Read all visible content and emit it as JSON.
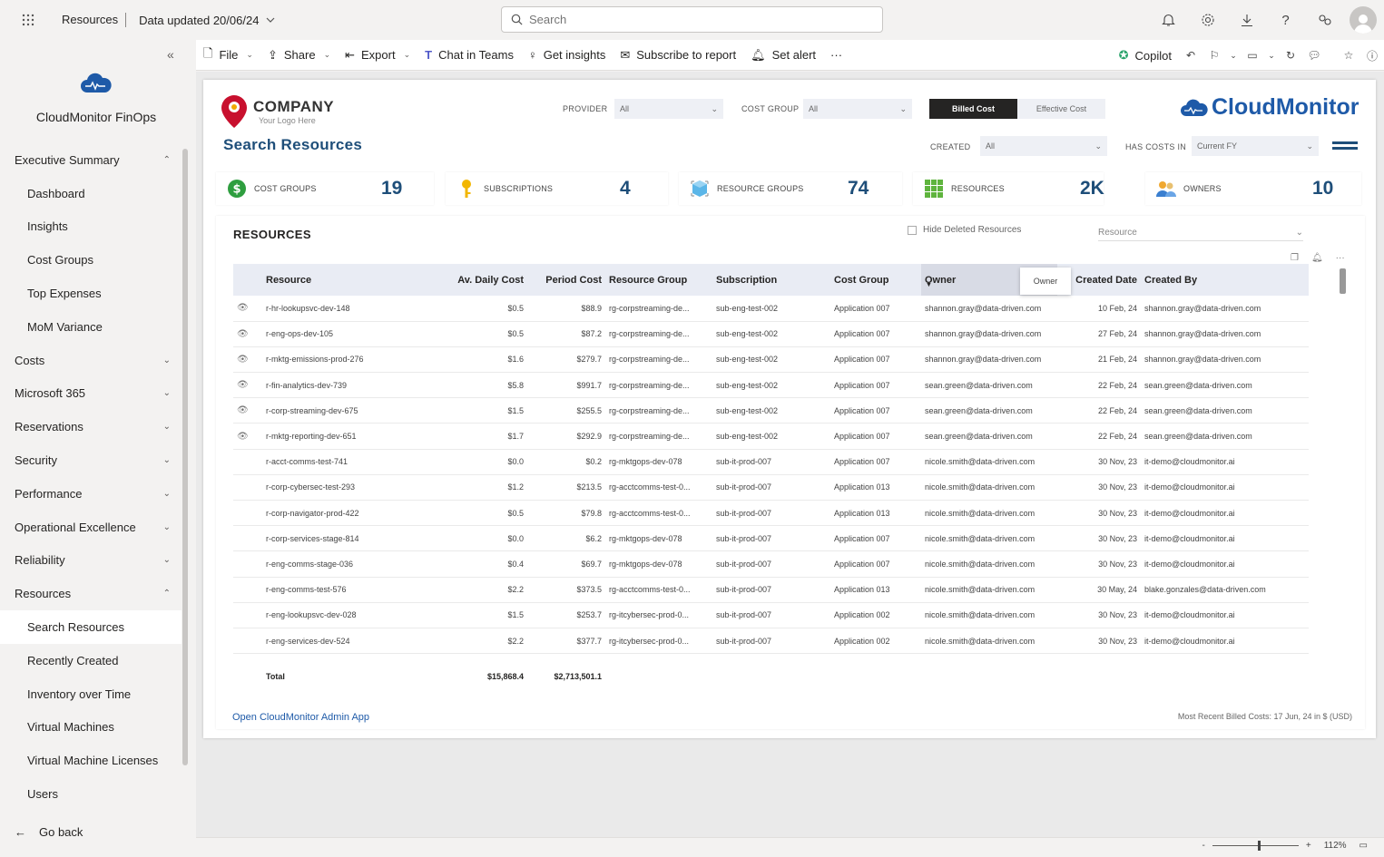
{
  "topbar": {
    "resources_label": "Resources",
    "data_updated": "Data updated 20/06/24",
    "search_placeholder": "Search"
  },
  "toolbar": {
    "file": "File",
    "share": "Share",
    "export": "Export",
    "chat_in_teams": "Chat in Teams",
    "get_insights": "Get insights",
    "subscribe": "Subscribe to report",
    "set_alert": "Set alert",
    "more": "···",
    "copilot": "Copilot"
  },
  "sidebar": {
    "app_title": "CloudMonitor FinOps",
    "items": [
      {
        "label": "Executive Summary",
        "chev": "⌃",
        "sub": false
      },
      {
        "label": "Dashboard",
        "chev": "",
        "sub": true
      },
      {
        "label": "Insights",
        "chev": "",
        "sub": true
      },
      {
        "label": "Cost Groups",
        "chev": "",
        "sub": true
      },
      {
        "label": "Top Expenses",
        "chev": "",
        "sub": true
      },
      {
        "label": "MoM Variance",
        "chev": "",
        "sub": true
      },
      {
        "label": "Costs",
        "chev": "⌄",
        "sub": false
      },
      {
        "label": "Microsoft 365",
        "chev": "⌄",
        "sub": false
      },
      {
        "label": "Reservations",
        "chev": "⌄",
        "sub": false
      },
      {
        "label": "Security",
        "chev": "⌄",
        "sub": false
      },
      {
        "label": "Performance",
        "chev": "⌄",
        "sub": false
      },
      {
        "label": "Operational Excellence",
        "chev": "⌄",
        "sub": false
      },
      {
        "label": "Reliability",
        "chev": "⌄",
        "sub": false
      },
      {
        "label": "Resources",
        "chev": "⌃",
        "sub": false
      },
      {
        "label": "Search Resources",
        "chev": "",
        "sub": true,
        "active": true
      },
      {
        "label": "Recently Created",
        "chev": "",
        "sub": true
      },
      {
        "label": "Inventory over Time",
        "chev": "",
        "sub": true
      },
      {
        "label": "Virtual Machines",
        "chev": "",
        "sub": true
      },
      {
        "label": "Virtual Machine Licenses",
        "chev": "",
        "sub": true
      },
      {
        "label": "Users",
        "chev": "",
        "sub": true
      }
    ],
    "go_back": "Go back"
  },
  "report": {
    "logo_company": "COMPANY",
    "logo_tagline": "Your Logo Here",
    "page_title": "Search Resources",
    "brand": "CloudMonitor",
    "filters": {
      "provider_label": "PROVIDER",
      "provider_value": "All",
      "cost_group_label": "COST GROUP",
      "cost_group_value": "All",
      "created_label": "CREATED",
      "created_value": "All",
      "has_costs_label": "HAS COSTS IN",
      "has_costs_value": "Current FY",
      "billed_cost": "Billed Cost",
      "effective_cost": "Effective Cost"
    },
    "kpis": [
      {
        "label": "COST GROUPS",
        "value": "19",
        "icon": "dollar-icon"
      },
      {
        "label": "SUBSCRIPTIONS",
        "value": "4",
        "icon": "key-icon"
      },
      {
        "label": "RESOURCE GROUPS",
        "value": "74",
        "icon": "cube-icon"
      },
      {
        "label": "RESOURCES",
        "value": "2K",
        "icon": "grid-icon"
      },
      {
        "label": "OWNERS",
        "value": "10",
        "icon": "users-icon"
      }
    ],
    "panel": {
      "title": "RESOURCES",
      "hide_deleted": "Hide Deleted Resources",
      "resource_slicer": "Resource",
      "owner_tooltip": "Owner"
    },
    "table": {
      "headers": [
        "Resource",
        "Av. Daily Cost",
        "Period Cost",
        "Resource Group",
        "Subscription",
        "Cost Group",
        "Owner",
        "Created Date",
        "Created By"
      ],
      "rows": [
        {
          "eye": true,
          "resource": "r-hr-lookupsvc-dev-148",
          "daily": "$0.5",
          "period": "$88.9",
          "rg": "rg-corpstreaming-de...",
          "sub": "sub-eng-test-002",
          "cg": "Application 007",
          "owner": "shannon.gray@data-driven.com",
          "date": "10 Feb, 24",
          "by": "shannon.gray@data-driven.com"
        },
        {
          "eye": true,
          "resource": "r-eng-ops-dev-105",
          "daily": "$0.5",
          "period": "$87.2",
          "rg": "rg-corpstreaming-de...",
          "sub": "sub-eng-test-002",
          "cg": "Application 007",
          "owner": "shannon.gray@data-driven.com",
          "date": "27 Feb, 24",
          "by": "shannon.gray@data-driven.com"
        },
        {
          "eye": true,
          "resource": "r-mktg-emissions-prod-276",
          "daily": "$1.6",
          "period": "$279.7",
          "rg": "rg-corpstreaming-de...",
          "sub": "sub-eng-test-002",
          "cg": "Application 007",
          "owner": "shannon.gray@data-driven.com",
          "date": "21 Feb, 24",
          "by": "shannon.gray@data-driven.com"
        },
        {
          "eye": true,
          "resource": "r-fin-analytics-dev-739",
          "daily": "$5.8",
          "period": "$991.7",
          "rg": "rg-corpstreaming-de...",
          "sub": "sub-eng-test-002",
          "cg": "Application 007",
          "owner": "sean.green@data-driven.com",
          "date": "22 Feb, 24",
          "by": "sean.green@data-driven.com"
        },
        {
          "eye": true,
          "resource": "r-corp-streaming-dev-675",
          "daily": "$1.5",
          "period": "$255.5",
          "rg": "rg-corpstreaming-de...",
          "sub": "sub-eng-test-002",
          "cg": "Application 007",
          "owner": "sean.green@data-driven.com",
          "date": "22 Feb, 24",
          "by": "sean.green@data-driven.com"
        },
        {
          "eye": true,
          "resource": "r-mktg-reporting-dev-651",
          "daily": "$1.7",
          "period": "$292.9",
          "rg": "rg-corpstreaming-de...",
          "sub": "sub-eng-test-002",
          "cg": "Application 007",
          "owner": "sean.green@data-driven.com",
          "date": "22 Feb, 24",
          "by": "sean.green@data-driven.com"
        },
        {
          "eye": false,
          "resource": "r-acct-comms-test-741",
          "daily": "$0.0",
          "period": "$0.2",
          "rg": "rg-mktgops-dev-078",
          "sub": "sub-it-prod-007",
          "cg": "Application 007",
          "owner": "nicole.smith@data-driven.com",
          "date": "30 Nov, 23",
          "by": "it-demo@cloudmonitor.ai"
        },
        {
          "eye": false,
          "resource": "r-corp-cybersec-test-293",
          "daily": "$1.2",
          "period": "$213.5",
          "rg": "rg-acctcomms-test-0...",
          "sub": "sub-it-prod-007",
          "cg": "Application 013",
          "owner": "nicole.smith@data-driven.com",
          "date": "30 Nov, 23",
          "by": "it-demo@cloudmonitor.ai"
        },
        {
          "eye": false,
          "resource": "r-corp-navigator-prod-422",
          "daily": "$0.5",
          "period": "$79.8",
          "rg": "rg-acctcomms-test-0...",
          "sub": "sub-it-prod-007",
          "cg": "Application 013",
          "owner": "nicole.smith@data-driven.com",
          "date": "30 Nov, 23",
          "by": "it-demo@cloudmonitor.ai"
        },
        {
          "eye": false,
          "resource": "r-corp-services-stage-814",
          "daily": "$0.0",
          "period": "$6.2",
          "rg": "rg-mktgops-dev-078",
          "sub": "sub-it-prod-007",
          "cg": "Application 007",
          "owner": "nicole.smith@data-driven.com",
          "date": "30 Nov, 23",
          "by": "it-demo@cloudmonitor.ai"
        },
        {
          "eye": false,
          "resource": "r-eng-comms-stage-036",
          "daily": "$0.4",
          "period": "$69.7",
          "rg": "rg-mktgops-dev-078",
          "sub": "sub-it-prod-007",
          "cg": "Application 007",
          "owner": "nicole.smith@data-driven.com",
          "date": "30 Nov, 23",
          "by": "it-demo@cloudmonitor.ai"
        },
        {
          "eye": false,
          "resource": "r-eng-comms-test-576",
          "daily": "$2.2",
          "period": "$373.5",
          "rg": "rg-acctcomms-test-0...",
          "sub": "sub-it-prod-007",
          "cg": "Application 013",
          "owner": "nicole.smith@data-driven.com",
          "date": "30 May, 24",
          "by": "blake.gonzales@data-driven.com"
        },
        {
          "eye": false,
          "resource": "r-eng-lookupsvc-dev-028",
          "daily": "$1.5",
          "period": "$253.7",
          "rg": "rg-itcybersec-prod-0...",
          "sub": "sub-it-prod-007",
          "cg": "Application 002",
          "owner": "nicole.smith@data-driven.com",
          "date": "30 Nov, 23",
          "by": "it-demo@cloudmonitor.ai"
        },
        {
          "eye": false,
          "resource": "r-eng-services-dev-524",
          "daily": "$2.2",
          "period": "$377.7",
          "rg": "rg-itcybersec-prod-0...",
          "sub": "sub-it-prod-007",
          "cg": "Application 002",
          "owner": "nicole.smith@data-driven.com",
          "date": "30 Nov, 23",
          "by": "it-demo@cloudmonitor.ai"
        }
      ],
      "total": {
        "label": "Total",
        "daily": "$15,868.4",
        "period": "$2,713,501.1"
      }
    },
    "admin_link": "Open CloudMonitor Admin App",
    "footnote": "Most Recent Billed Costs: 17 Jun, 24 in $ (USD)"
  },
  "status": {
    "zoom": "112%",
    "minus": "-",
    "plus": "+"
  },
  "colors": {
    "accent": "#1e4e79",
    "brand": "#1e5aa8",
    "header_bg": "#e9ecf4"
  }
}
